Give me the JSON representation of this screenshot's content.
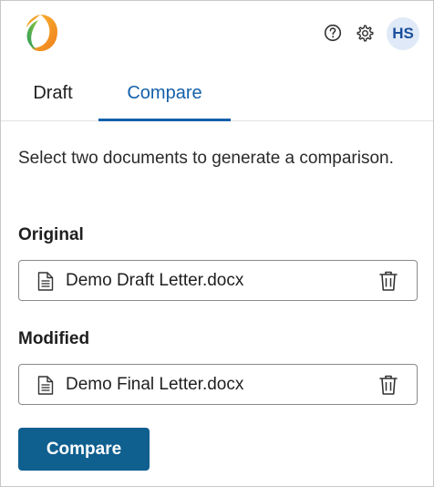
{
  "header": {
    "logo_icon": "orange-swirl-logo-icon",
    "help_icon": "question-circle-icon",
    "settings_icon": "gear-icon",
    "avatar_initials": "HS"
  },
  "tabs": [
    {
      "label": "Draft",
      "active": false
    },
    {
      "label": "Compare",
      "active": true
    }
  ],
  "compare": {
    "instructions": "Select two documents to generate a comparison.",
    "original": {
      "label": "Original",
      "file_name": "Demo Draft Letter.docx",
      "file_icon": "document-icon",
      "remove_icon": "trash-icon"
    },
    "modified": {
      "label": "Modified",
      "file_name": "Demo Final Letter.docx",
      "file_icon": "document-icon",
      "remove_icon": "trash-icon"
    },
    "compare_button_label": "Compare"
  },
  "colors": {
    "accent": "#1460aa",
    "button": "#0f5f8f",
    "avatar_bg": "#dfe9f7"
  }
}
